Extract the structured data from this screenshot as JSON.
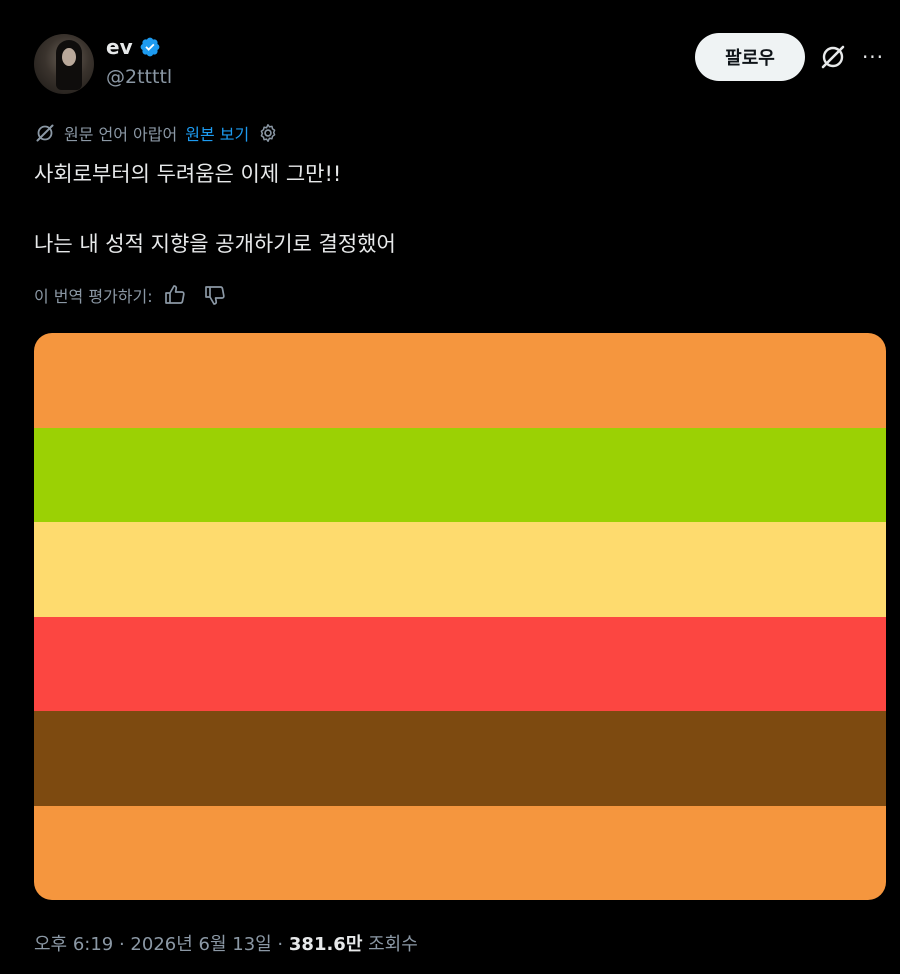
{
  "author": {
    "display_name": "ev",
    "handle": "@2ttttl",
    "verified": true
  },
  "actions": {
    "follow_label": "팔로우",
    "grok_icon": "grok-icon",
    "more_icon": "more-icon",
    "more_glyph": "···"
  },
  "translation": {
    "note": "원문 언어 아랍어",
    "view_original": "원본 보기",
    "rate_label": "이 번역 평가하기:"
  },
  "tweet": {
    "line1": "사회로부터의 두려움은 이제 그만!!",
    "line2": "나는 내 성적 지향을 공개하기로 결정했어"
  },
  "media": {
    "stripes": [
      {
        "color": "#F5963E"
      },
      {
        "color": "#9BD104"
      },
      {
        "color": "#FEDB6E"
      },
      {
        "color": "#FC4641"
      },
      {
        "color": "#7D4A10"
      },
      {
        "color": "#F5963E"
      }
    ]
  },
  "meta": {
    "time_date": "오후 6:19 · 2026년 6월 13일 · ",
    "views_count": "381.6만",
    "views_label": " 조회수"
  },
  "colors": {
    "background": "#000000",
    "text_primary": "#e7e9ea",
    "text_secondary": "#8b98a5",
    "link": "#1d9bf0",
    "verified_badge": "#1d9bf0"
  }
}
